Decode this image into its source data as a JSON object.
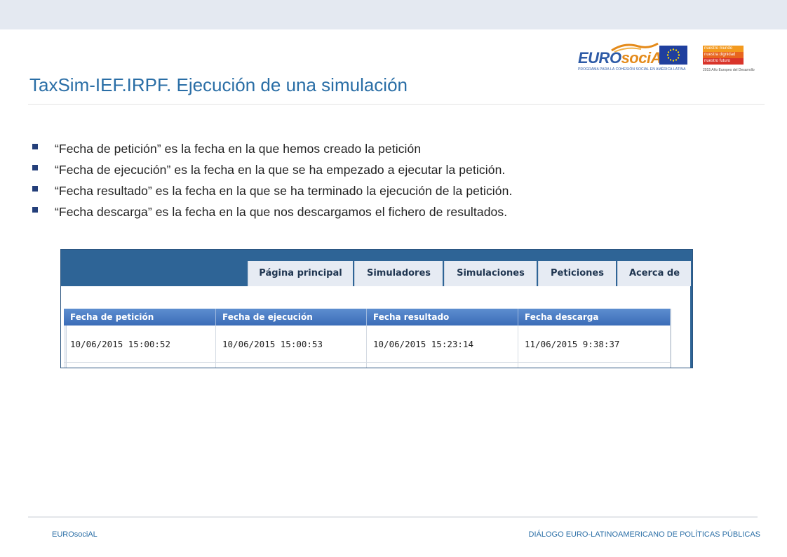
{
  "slide": {
    "title": "TaxSim-IEF.IRPF. Ejecución de una simulación",
    "bullets": [
      "“Fecha de petición” es la fecha en la que hemos creado la petición",
      "“Fecha de ejecución” es la fecha en la que se ha empezado a ejecutar la petición.",
      "“Fecha resultado” es la fecha en la que se ha terminado la ejecución de la petición.",
      "“Fecha descarga” es la fecha en la que nos descargamos el fichero de resultados."
    ]
  },
  "logos": {
    "eurosocial_word_blue": "EURO",
    "eurosocial_word_orange": "sociAL",
    "eurosocial_sub": "PROGRAMA PARA LA COHESIÓN SOCIAL EN AMÉRICA LATINA",
    "nm_lines": [
      "nuestro mundo",
      "nuestra dignidad",
      "nuestro futuro"
    ],
    "nm_year": "2015 Año Europeo del Desarrollo"
  },
  "app": {
    "nav": [
      "Página principal",
      "Simuladores",
      "Simulaciones",
      "Peticiones",
      "Acerca de"
    ],
    "columns": [
      "Fecha de petición",
      "Fecha de ejecución",
      "Fecha resultado",
      "Fecha descarga"
    ],
    "row": [
      "10/06/2015 15:00:52",
      "10/06/2015 15:00:53",
      "10/06/2015 15:23:14",
      "11/06/2015 9:38:37"
    ]
  },
  "footer": {
    "left": "EUROsociAL",
    "right": "DIÁLOGO EURO-LATINOAMERICANO DE POLÍTICAS PÚBLICAS"
  },
  "colors": {
    "title": "#2a6ea6",
    "bullet": "#243f7a",
    "app_header": "#2e6496",
    "grid_header": "#3b6cb8",
    "footer_text": "#2a6ea6"
  }
}
